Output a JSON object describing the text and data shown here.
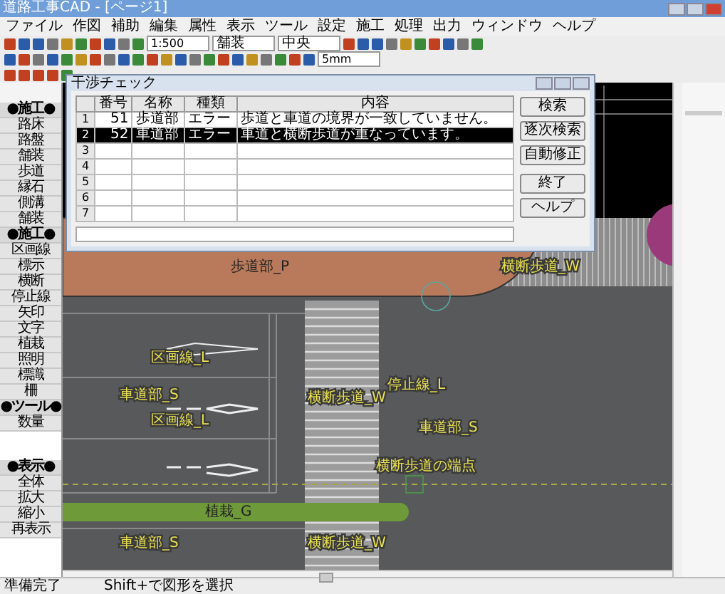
{
  "window": {
    "title": "道路工事CAD - [ページ1]"
  },
  "menu": [
    "ファイル",
    "作図",
    "補助",
    "編集",
    "属性",
    "表示",
    "ツール",
    "設定",
    "施工",
    "処理",
    "出力",
    "ウィンドウ",
    "ヘルプ"
  ],
  "toolbar": {
    "scale": "1:500",
    "layer": "舗装",
    "line": "中央",
    "text_size": "5mm"
  },
  "palette": {
    "upper": [
      {
        "label": "●施工●",
        "kind": "header"
      },
      {
        "label": "路床",
        "kind": "item"
      },
      {
        "label": "路盤",
        "kind": "item"
      },
      {
        "label": "舗装",
        "kind": "item"
      },
      {
        "label": "歩道",
        "kind": "item"
      },
      {
        "label": "縁石",
        "kind": "item"
      },
      {
        "label": "側溝",
        "kind": "item"
      },
      {
        "label": "舗装",
        "kind": "item"
      },
      {
        "label": "●施工●",
        "kind": "header"
      },
      {
        "label": "区画線",
        "kind": "item"
      },
      {
        "label": "標示",
        "kind": "item"
      },
      {
        "label": "横断",
        "kind": "item"
      },
      {
        "label": "停止線",
        "kind": "item"
      },
      {
        "label": "矢印",
        "kind": "item"
      },
      {
        "label": "文字",
        "kind": "item"
      },
      {
        "label": "植栽",
        "kind": "item"
      },
      {
        "label": "照明",
        "kind": "item"
      },
      {
        "label": "標識",
        "kind": "item"
      },
      {
        "label": "柵",
        "kind": "item"
      },
      {
        "label": "●ツール●",
        "kind": "header"
      },
      {
        "label": "数量",
        "kind": "item"
      }
    ],
    "lower": [
      {
        "label": "●表示●",
        "kind": "header"
      },
      {
        "label": "全体",
        "kind": "item"
      },
      {
        "label": "拡大",
        "kind": "item"
      },
      {
        "label": "縮小",
        "kind": "item"
      },
      {
        "label": "再表示",
        "kind": "item"
      }
    ]
  },
  "dialog": {
    "title": "干渉チェック",
    "columns": [
      "番号",
      "名称",
      "種類",
      "内容"
    ],
    "rows": [
      {
        "number": "1",
        "id": "51",
        "name": "歩道部",
        "type": "エラー",
        "content": "歩道と車道の境界が一致していません。",
        "selected": false
      },
      {
        "number": "2",
        "id": "52",
        "name": "車道部",
        "type": "エラー",
        "content": "車道と横断歩道が重なっています。",
        "selected": true
      },
      {
        "number": "3",
        "selected": false
      },
      {
        "number": "4",
        "selected": false
      },
      {
        "number": "5",
        "selected": false
      },
      {
        "number": "6",
        "selected": false
      },
      {
        "number": "7",
        "selected": false
      }
    ],
    "buttons": [
      "検索",
      "逐次検索",
      "自動修正",
      "終了",
      "ヘルプ"
    ]
  },
  "canvas": {
    "labels": [
      {
        "text": "歩道部_P",
        "kind": "area"
      },
      {
        "text": "横断歩道_W",
        "kind": "note"
      },
      {
        "text": "区画線_L",
        "kind": "note"
      },
      {
        "text": "車道部_S",
        "kind": "note"
      },
      {
        "text": "停止線_L",
        "kind": "note"
      },
      {
        "text": "横断歩道_W",
        "kind": "note"
      },
      {
        "text": "区画線_L",
        "kind": "note"
      },
      {
        "text": "車道部_S",
        "kind": "note"
      },
      {
        "text": "横断歩道の端点",
        "kind": "note"
      },
      {
        "text": "植栽_G",
        "kind": "area"
      },
      {
        "text": "車道部_S",
        "kind": "note"
      },
      {
        "text": "横断歩道_W",
        "kind": "note"
      }
    ]
  },
  "status_bar": {
    "left": "準備完了",
    "right": "Shift+で図形を選択"
  }
}
